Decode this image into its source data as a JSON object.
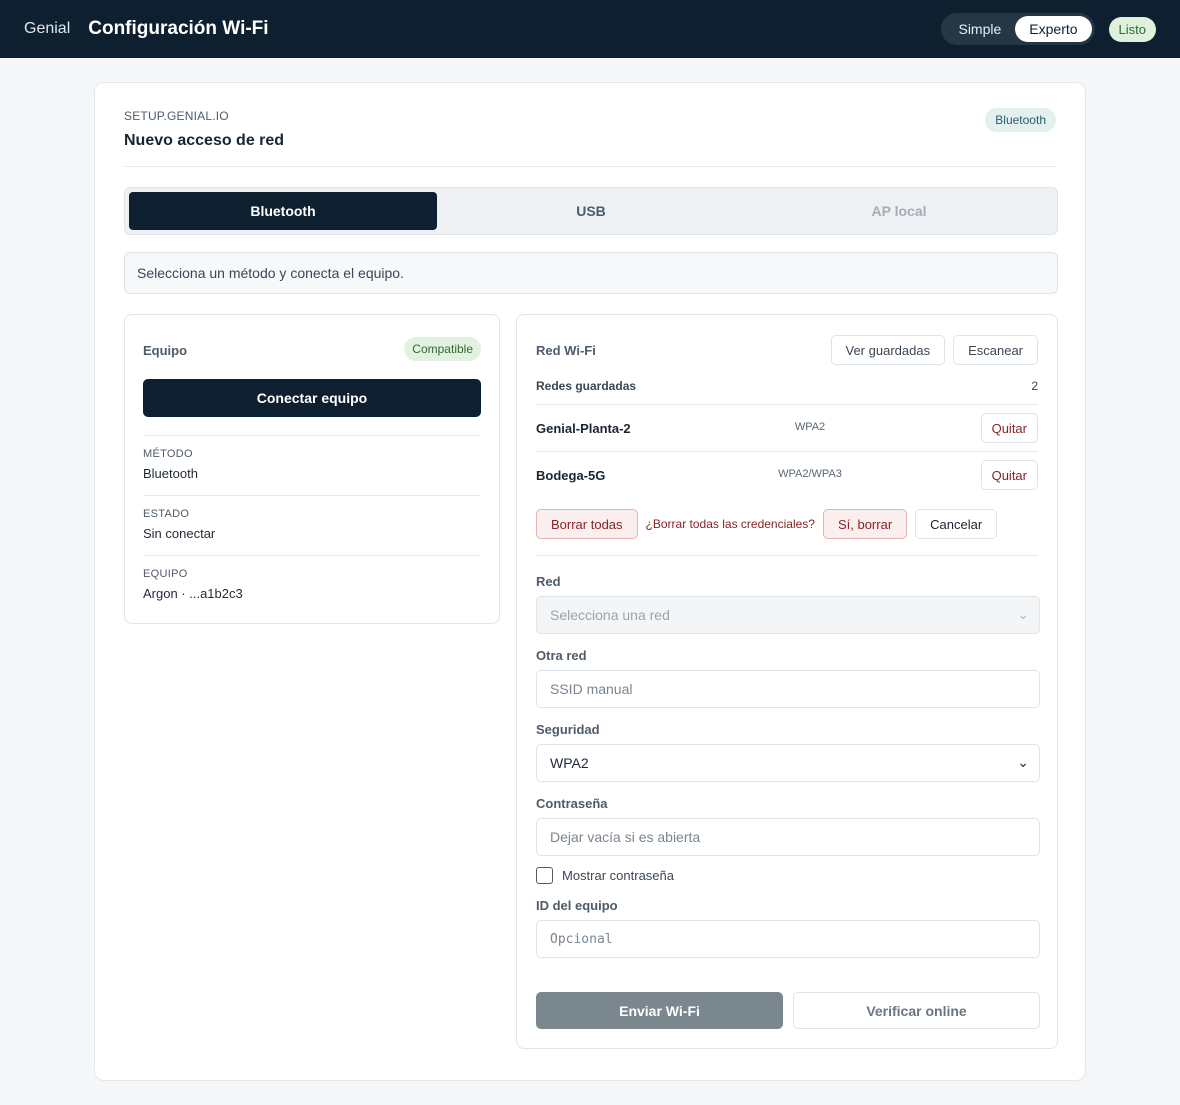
{
  "header": {
    "brand": "Genial",
    "title": "Configuración Wi-Fi",
    "modes": [
      "Simple",
      "Experto"
    ],
    "active_mode": "Experto",
    "status": "Listo"
  },
  "card": {
    "eyebrow": "SETUP.GENIAL.IO",
    "title": "Nuevo acceso de red",
    "badge": "Bluetooth"
  },
  "tabs": [
    {
      "label": "Bluetooth",
      "state": "active"
    },
    {
      "label": "USB",
      "state": "normal"
    },
    {
      "label": "AP local",
      "state": "disabled"
    }
  ],
  "hint": "Selecciona un método y conecta el equipo.",
  "device": {
    "label": "Equipo",
    "badge": "Compatible",
    "connect_label": "Conectar equipo",
    "info": [
      {
        "key": "MÉTODO",
        "value": "Bluetooth"
      },
      {
        "key": "ESTADO",
        "value": "Sin conectar"
      },
      {
        "key": "EQUIPO",
        "value": "Argon · ...a1b2c3"
      }
    ]
  },
  "wifi": {
    "label": "Red Wi-Fi",
    "view_saved_label": "Ver guardadas",
    "scan_label": "Escanear",
    "saved_title": "Redes guardadas",
    "saved_count": "2",
    "networks": [
      {
        "name": "Genial-Planta-2",
        "security": "WPA2",
        "remove": "Quitar"
      },
      {
        "name": "Bodega-5G",
        "security": "WPA2/WPA3",
        "remove": "Quitar"
      }
    ],
    "delete_all_label": "Borrar todas",
    "confirm_question": "¿Borrar todas las credenciales?",
    "confirm_yes": "Sí, borrar",
    "confirm_cancel": "Cancelar",
    "fields": {
      "network_label": "Red",
      "network_placeholder": "Selecciona una red",
      "other_label": "Otra red",
      "other_placeholder": "SSID manual",
      "security_label": "Seguridad",
      "security_value": "WPA2",
      "password_label": "Contraseña",
      "password_placeholder": "Dejar vacía si es abierta",
      "show_password_label": "Mostrar contraseña",
      "show_password_checked": false,
      "device_id_label": "ID del equipo",
      "device_id_placeholder": "Opcional"
    },
    "send_label": "Enviar Wi-Fi",
    "verify_label": "Verificar online"
  }
}
